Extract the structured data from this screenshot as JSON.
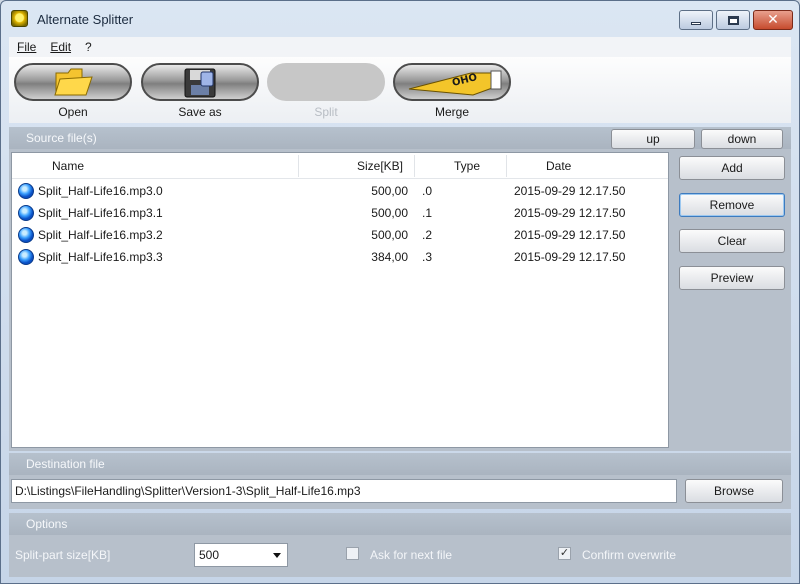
{
  "window": {
    "title": "Alternate Splitter"
  },
  "menu": {
    "items": [
      "File",
      "Edit",
      "?"
    ]
  },
  "toolbar": {
    "open": "Open",
    "save_as": "Save as",
    "split": "Split",
    "merge": "Merge",
    "merge_logo": "OHO"
  },
  "source": {
    "title": "Source file(s)",
    "up": "up",
    "down": "down",
    "columns": [
      "Name",
      "Size[KB]",
      "Type",
      "Date"
    ],
    "rows": [
      {
        "name": "Split_Half-Life16.mp3.0",
        "size": "500,00",
        "type": ".0",
        "date": "2015-09-29 12.17.50"
      },
      {
        "name": "Split_Half-Life16.mp3.1",
        "size": "500,00",
        "type": ".1",
        "date": "2015-09-29 12.17.50"
      },
      {
        "name": "Split_Half-Life16.mp3.2",
        "size": "500,00",
        "type": ".2",
        "date": "2015-09-29 12.17.50"
      },
      {
        "name": "Split_Half-Life16.mp3.3",
        "size": "384,00",
        "type": ".3",
        "date": "2015-09-29 12.17.50"
      }
    ],
    "buttons": {
      "add": "Add",
      "remove": "Remove",
      "clear": "Clear",
      "preview": "Preview"
    }
  },
  "destination": {
    "title": "Destination file",
    "path": "D:\\Listings\\FileHandling\\Splitter\\Version1-3\\Split_Half-Life16.mp3",
    "browse": "Browse"
  },
  "options": {
    "title": "Options",
    "split_size_label": "Split-part size[KB]",
    "split_size_value": "500",
    "ask_next_file": {
      "label": "Ask for next file",
      "checked": false
    },
    "confirm_overwrite": {
      "label": "Confirm overwrite",
      "checked": true
    }
  },
  "icons": {
    "open": "folder-icon",
    "save_as": "floppy-disk-icon",
    "merge": "glue-tube-icon",
    "file": "audio-file-icon"
  }
}
